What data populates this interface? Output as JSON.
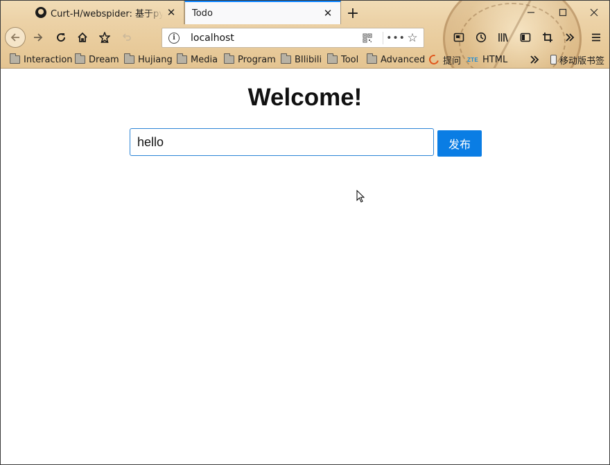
{
  "browser": {
    "tabs": [
      {
        "title": "Curt-H/webspider: 基于pytho",
        "active": false,
        "favicon": "github-icon"
      },
      {
        "title": "Todo",
        "active": true
      }
    ],
    "new_tab_label": "+",
    "url": "localhost",
    "bookmarks": [
      {
        "label": "Interaction",
        "icon": "folder-icon"
      },
      {
        "label": "Dream",
        "icon": "folder-icon"
      },
      {
        "label": "Hujiang",
        "icon": "folder-icon"
      },
      {
        "label": "Media",
        "icon": "folder-icon"
      },
      {
        "label": "Program",
        "icon": "folder-icon"
      },
      {
        "label": "BIlibili",
        "icon": "folder-icon"
      },
      {
        "label": "Tool",
        "icon": "folder-icon"
      },
      {
        "label": "Advanced",
        "icon": "folder-icon"
      },
      {
        "label": "提问",
        "icon": "c-logo-icon"
      },
      {
        "label": "HTML",
        "icon": "zte-icon",
        "icon_text": "ZTE"
      }
    ],
    "mobile_bookmarks_label": "移动版书签",
    "accent_color": "#0a84ff"
  },
  "page": {
    "heading": "Welcome!",
    "input_value": "hello",
    "submit_label": "发布",
    "submit_color": "#0a7de4",
    "input_border_color": "#2a83d6"
  }
}
